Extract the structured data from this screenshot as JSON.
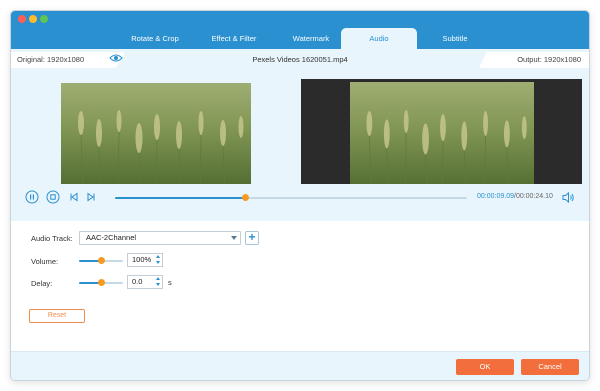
{
  "window": {
    "traffic_lights": [
      "close",
      "minimize",
      "maximize"
    ]
  },
  "tabs": [
    {
      "label": "Rotate & Crop",
      "active": false
    },
    {
      "label": "Effect & Filter",
      "active": false
    },
    {
      "label": "Watermark",
      "active": false
    },
    {
      "label": "Audio",
      "active": true
    },
    {
      "label": "Subtitle",
      "active": false
    }
  ],
  "preview": {
    "original_label": "Original: 1920x1080",
    "output_label": "Output: 1920x1080",
    "filename": "Pexels Videos 1620051.mp4",
    "toggle_icon": "eye-icon"
  },
  "player": {
    "current_time": "00:00:09.09",
    "separator": "/",
    "total_time": "00:00:24.10",
    "progress": 0.37,
    "icons": [
      "pause-icon",
      "stop-icon",
      "previous-icon",
      "next-icon",
      "volume-icon"
    ]
  },
  "audio": {
    "track_label": "Audio Track:",
    "track_value": "AAC-2Channel",
    "add_icon": "plus-icon",
    "volume_label": "Volume:",
    "volume_value": "100%",
    "volume_level": 0.5,
    "delay_label": "Delay:",
    "delay_value": "0.0",
    "delay_unit": "s",
    "delay_level": 0.5,
    "reset_label": "Reset"
  },
  "footer": {
    "ok_label": "OK",
    "cancel_label": "Cancel"
  },
  "colors": {
    "accent": "#2a90cf",
    "orange": "#f26f3d",
    "panel": "#e9f5fc"
  }
}
